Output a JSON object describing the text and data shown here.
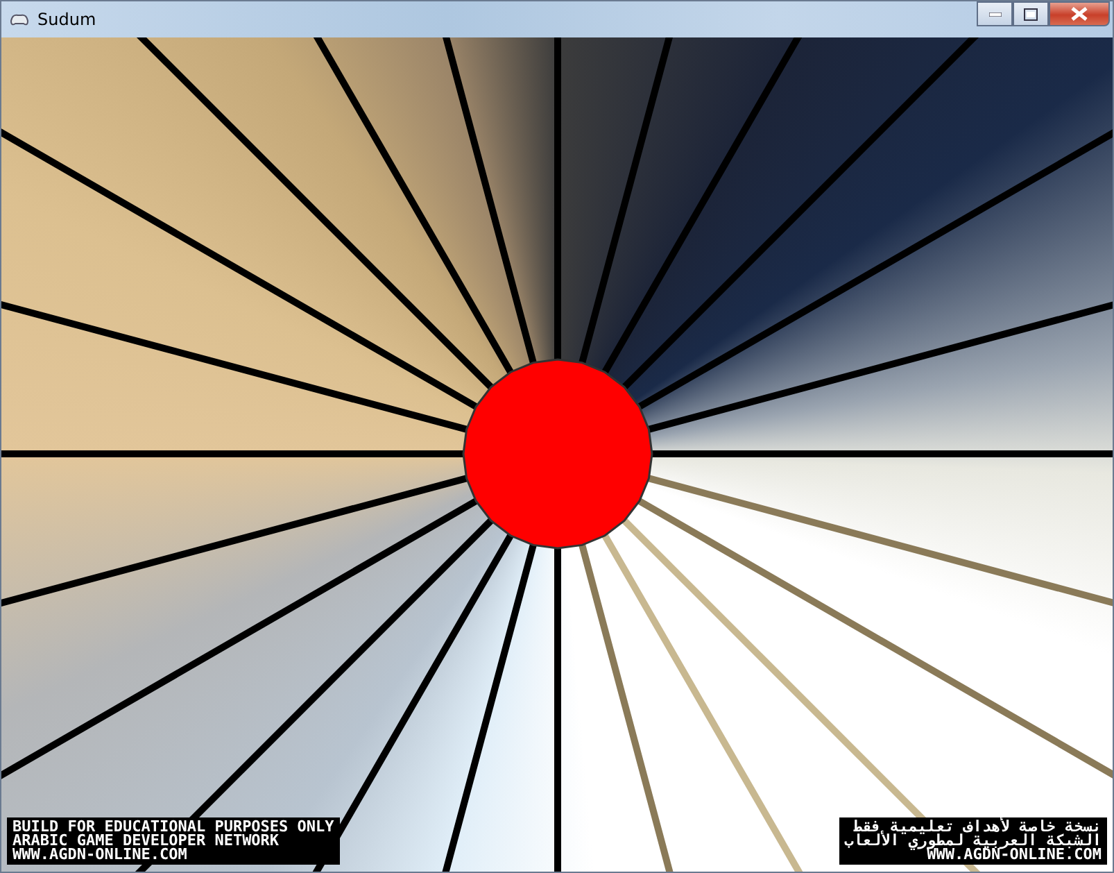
{
  "window": {
    "title": "Sudum"
  },
  "overlay_left": [
    "BUILD FOR EDUCATIONAL PURPOSES ONLY",
    "ARABIC GAME DEVELOPER NETWORK",
    "WWW.AGDN-ONLINE.COM"
  ],
  "overlay_right": [
    "نسخة خاصة لأهداف تعليمية فقط",
    "الشبكة العربية لمطوري الألعاب",
    "WWW.AGDN-ONLINE.COM"
  ]
}
